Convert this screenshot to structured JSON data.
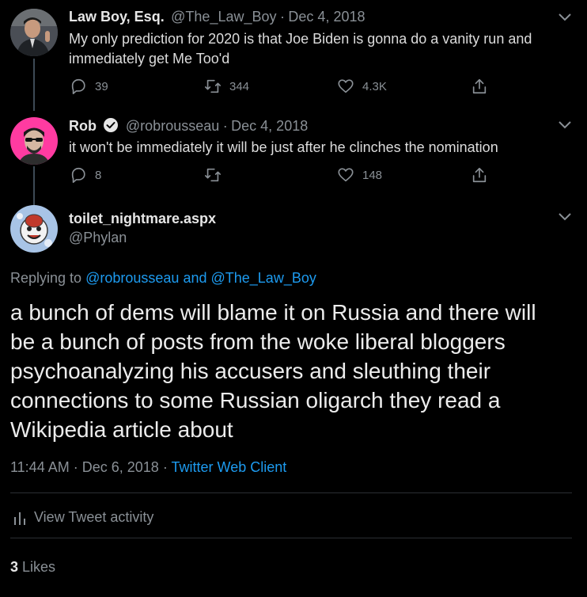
{
  "tweets": [
    {
      "name": "Law Boy, Esq.",
      "handle": "@The_Law_Boy",
      "sep": "·",
      "date": "Dec 4, 2018",
      "text": "My only prediction for 2020 is that Joe Biden is gonna do a vanity run and immediately get Me Too'd",
      "replies": "39",
      "retweets": "344",
      "likes": "4.3K",
      "verified": false
    },
    {
      "name": "Rob",
      "handle": "@robrousseau",
      "sep": "·",
      "date": "Dec 4, 2018",
      "text": "it won't be immediately it will be just after he clinches the nomination",
      "replies": "8",
      "retweets": "",
      "likes": "148",
      "verified": true
    }
  ],
  "main_tweet": {
    "name": "toilet_nightmare.aspx",
    "handle": "@Phylan",
    "replying_prefix": "Replying to",
    "replying_user1": "@robrousseau",
    "replying_and": "and",
    "replying_user2": "@The_Law_Boy",
    "text": "a bunch of dems will blame it on Russia and there will be a bunch of posts from the woke liberal bloggers psychoanalyzing his accusers and sleuthing their connections to some Russian oligarch they read a Wikipedia article about",
    "time": "11:44 AM",
    "sep": "·",
    "date": "Dec 6, 2018",
    "sep2": "·",
    "client": "Twitter Web Client",
    "activity": "View Tweet activity",
    "likes_count": "3",
    "likes_label": "Likes"
  },
  "colors": {
    "background": "#000000",
    "link": "#1d9bf0",
    "muted": "#8a9096",
    "avatar_rob_bg": "#ff3ba1"
  }
}
